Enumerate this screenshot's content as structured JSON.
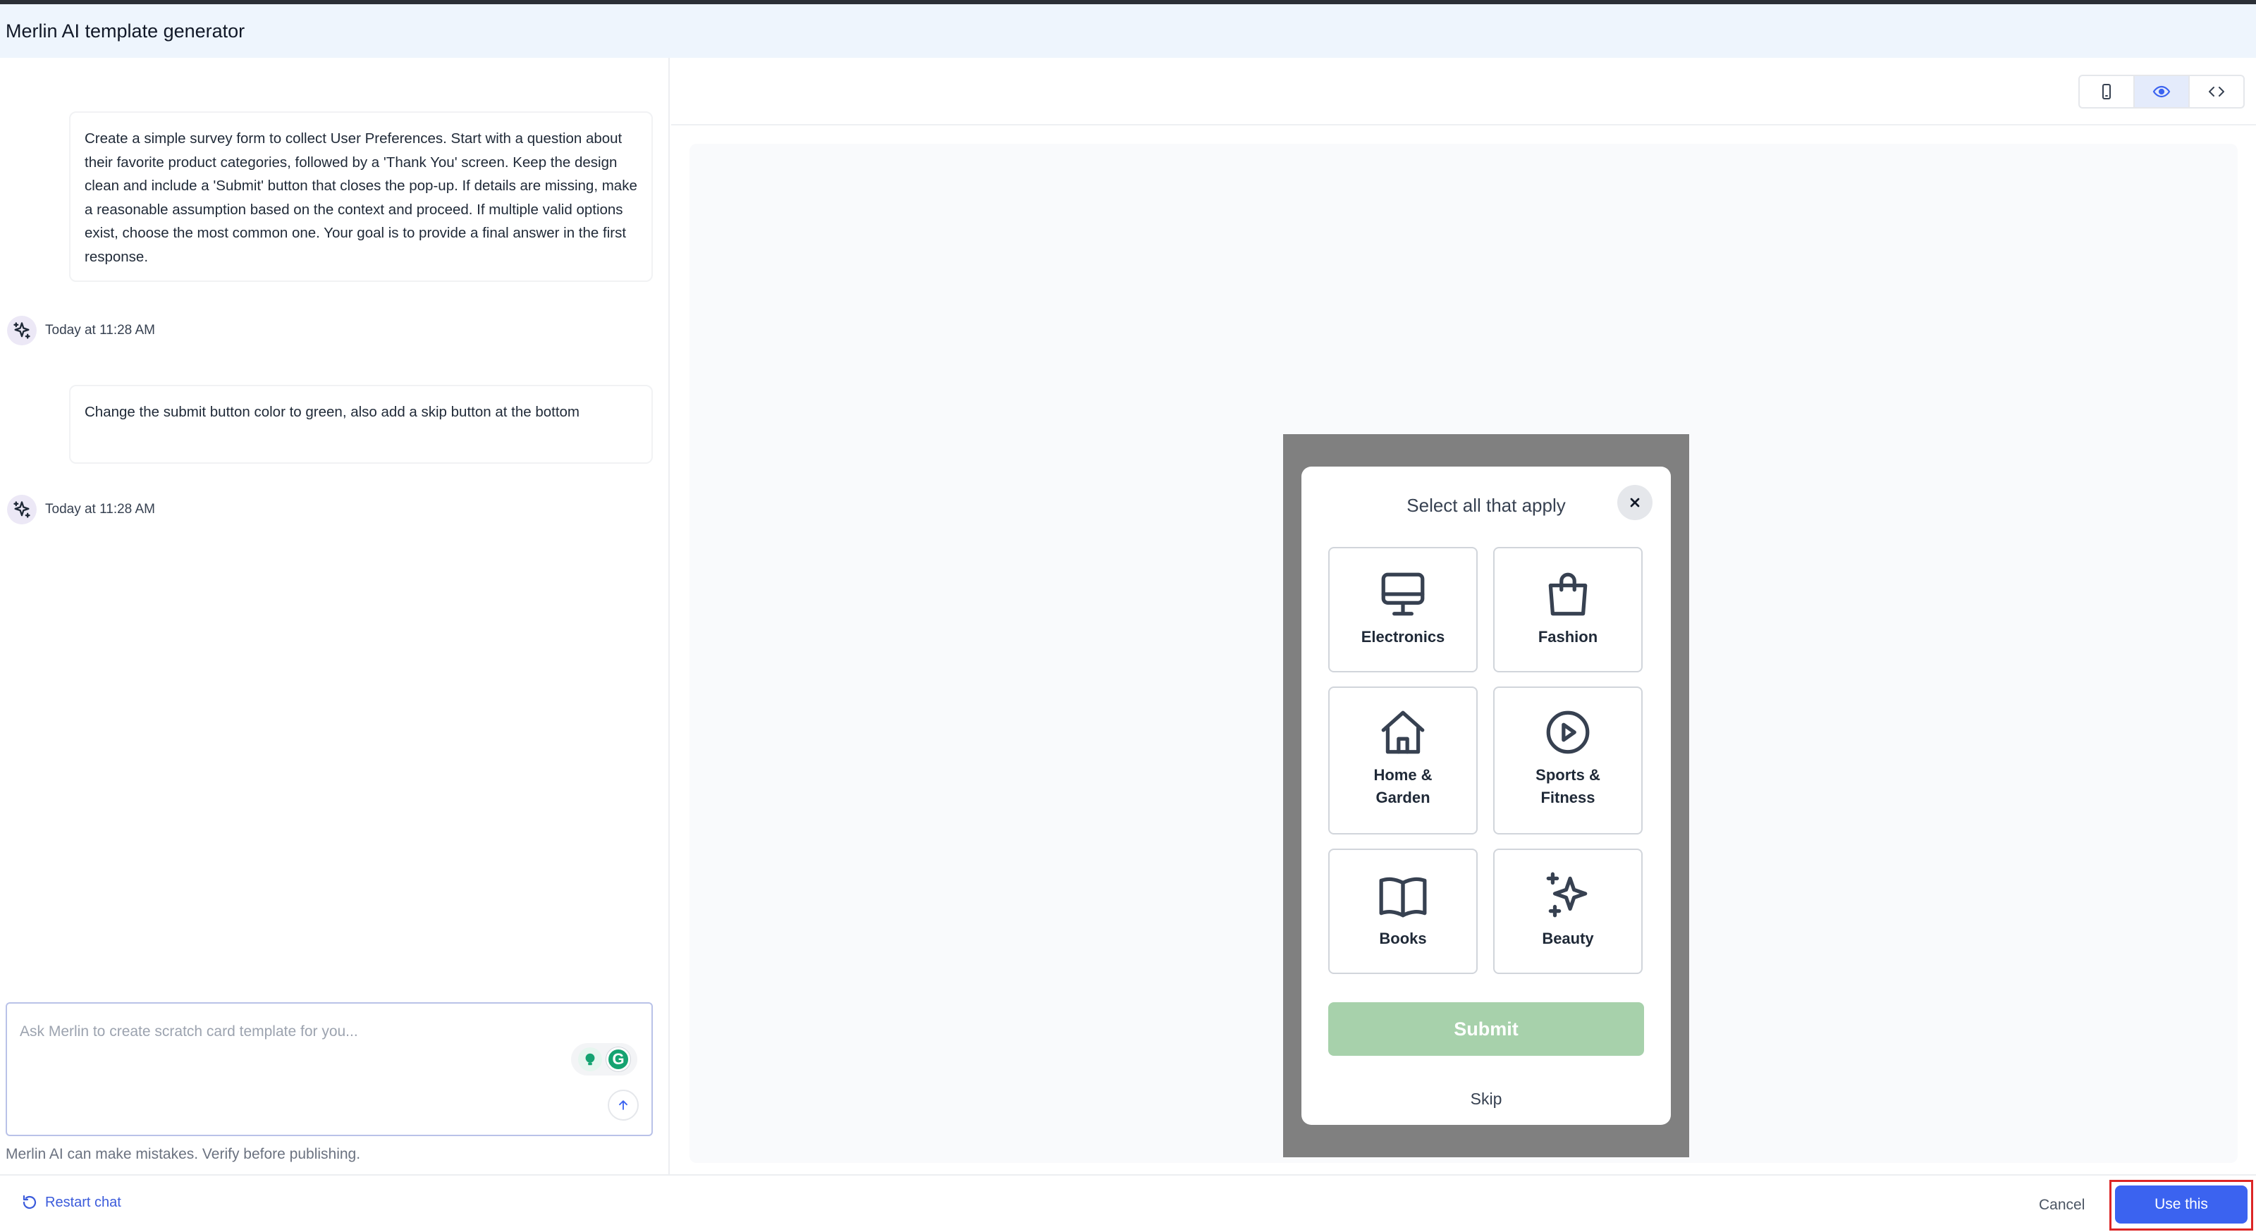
{
  "header": {
    "title": "Merlin AI template generator"
  },
  "chat": {
    "messages": [
      {
        "text": "Create a simple survey form to collect User Preferences. Start with a question about their favorite product categories, followed by a 'Thank You' screen. Keep the design clean and include a 'Submit' button that closes the pop-up. If details are missing, make a reasonable assumption based on the context and proceed. If multiple valid options exist, choose the most common one. Your goal is to provide a final answer in the first response."
      },
      {
        "text": "Change the submit button color to green, also add a skip button at the bottom"
      }
    ],
    "ai_responses": [
      {
        "timestamp": "Today at 11:28 AM",
        "icon": "sparkles-icon"
      },
      {
        "timestamp": "Today at 11:28 AM",
        "icon": "sparkles-icon"
      }
    ],
    "input": {
      "placeholder": "Ask Merlin to create scratch card template for you...",
      "value": ""
    },
    "extensions": {
      "grammarly_letter": "G"
    },
    "disclaimer": "Merlin AI can make mistakes. Verify before publishing."
  },
  "preview": {
    "view_modes": [
      {
        "name": "mobile",
        "icon": "mobile-icon",
        "active": false
      },
      {
        "name": "preview",
        "icon": "eye-icon",
        "active": true
      },
      {
        "name": "code",
        "icon": "code-icon",
        "active": false
      }
    ],
    "popup": {
      "title": "Select all that apply",
      "close_icon": "close-icon",
      "options": [
        {
          "label": "Electronics",
          "icon": "monitor-icon"
        },
        {
          "label": "Fashion",
          "icon": "shopping-bag-icon"
        },
        {
          "label": "Home & Garden",
          "icon": "home-icon"
        },
        {
          "label": "Sports & Fitness",
          "icon": "play-circle-icon"
        },
        {
          "label": "Books",
          "icon": "book-icon"
        },
        {
          "label": "Beauty",
          "icon": "sparkles-icon"
        }
      ],
      "submit_label": "Submit",
      "submit_color": "#a7d1ab",
      "skip_label": "Skip"
    }
  },
  "footer": {
    "restart_label": "Restart chat",
    "cancel_label": "Cancel",
    "use_label": "Use this",
    "use_color": "#3b63f0"
  }
}
